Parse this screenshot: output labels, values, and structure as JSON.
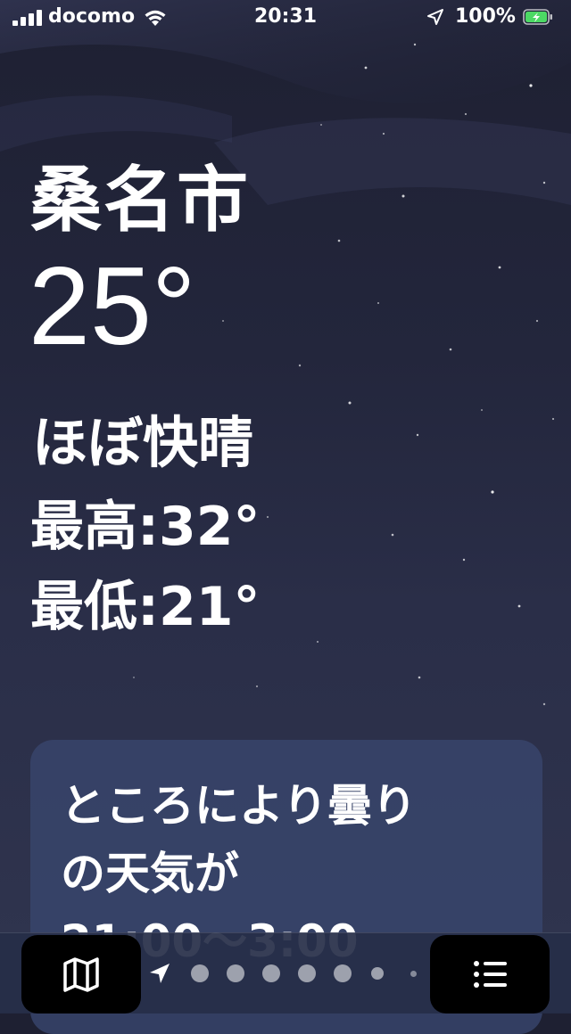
{
  "status_bar": {
    "carrier": "docomo",
    "time": "20:31",
    "battery_percent": "100%",
    "icons": [
      "signal-icon",
      "wifi-icon",
      "location-arrow-icon",
      "battery-charging-icon"
    ]
  },
  "weather": {
    "city": "桑名市",
    "temperature": "25°",
    "condition": "ほぼ快晴",
    "high": "最高:32°",
    "low": "最低:21°"
  },
  "forecast_card": {
    "lines": [
      "ところにより曇り",
      "の天気が",
      "21:00～3:00"
    ]
  },
  "bottom_bar": {
    "map_button_icon": "map-icon",
    "list_button_icon": "list-icon",
    "page_dots": 6,
    "current_page_icon": "location-arrow-icon"
  },
  "colors": {
    "sky_top": "#1e2032",
    "sky_bottom": "#30354f",
    "card": "#38466c",
    "battery_fill": "#4cd964",
    "text": "#ffffff"
  }
}
